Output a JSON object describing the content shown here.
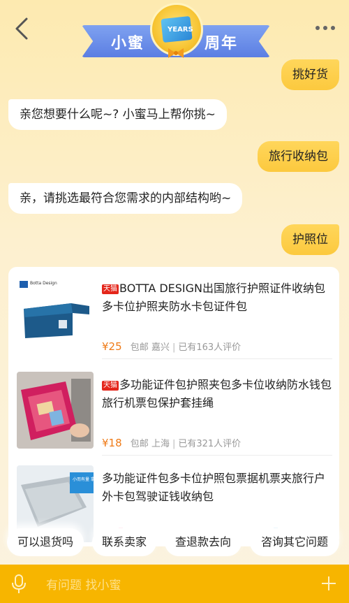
{
  "header": {
    "banner_left": "小蜜",
    "banner_right": "周年",
    "banner_medal": "YEARS"
  },
  "messages": [
    {
      "role": "user",
      "text": "挑好货"
    },
    {
      "role": "bot",
      "text": "亲您想要什么呢~? 小蜜马上帮你挑~"
    },
    {
      "role": "user",
      "text": "旅行收纳包"
    },
    {
      "role": "bot",
      "text": "亲，请挑选最符合您需求的内部结构哟~"
    },
    {
      "role": "user",
      "text": "护照位"
    }
  ],
  "products": [
    {
      "badge": "天猫",
      "title": "BOTTA DESIGN出国旅行护照证件收纳包多卡位护照夹防水卡包证件包",
      "price": "¥25",
      "shipping": "包邮",
      "location": "嘉兴",
      "reviews": "已有163人评价",
      "image_brand": "Botta Design"
    },
    {
      "badge": "天猫",
      "title": "多功能证件包护照夹包多卡位收纳防水钱包旅行机票包保护套挂绳",
      "price": "¥18",
      "shipping": "包邮",
      "location": "上海",
      "reviews": "已有321人评价"
    },
    {
      "badge": "",
      "title": "多功能证件包多卡位护照包票据机票夹旅行户外卡包驾驶证钱收纳包",
      "price": "",
      "shipping": "",
      "location": "",
      "reviews": "",
      "image_caption": "小而有量 拿起就走"
    }
  ],
  "quick_replies": [
    "可以退货吗",
    "联系卖家",
    "查退款去向",
    "咨询其它问题"
  ],
  "input": {
    "placeholder": "有问题 找小蜜"
  },
  "colors": {
    "accent": "#f7b500",
    "user_bubble": "#fcc93e",
    "price": "#ef7a16",
    "tmall": "#e4261b"
  }
}
